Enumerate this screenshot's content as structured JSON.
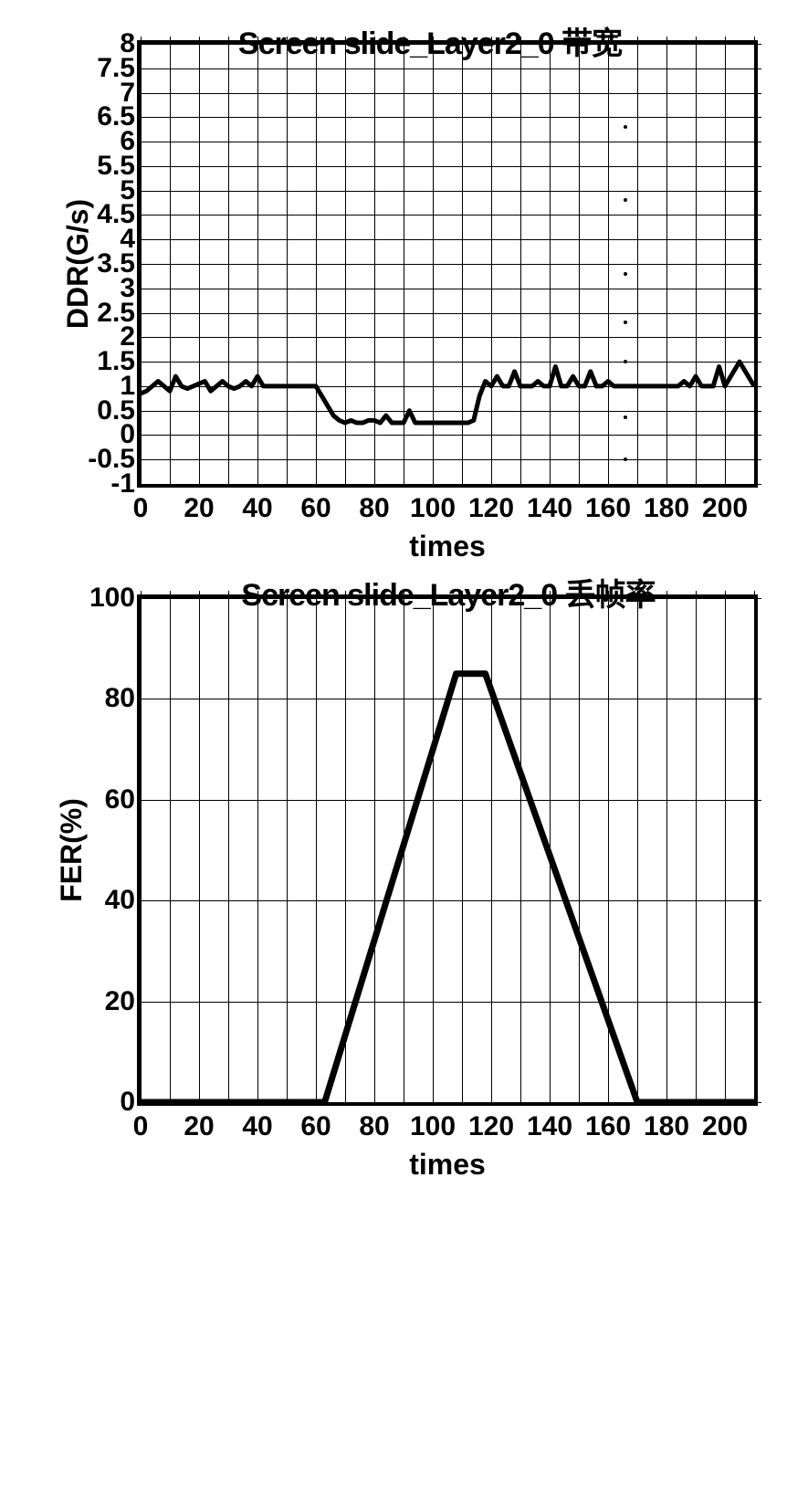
{
  "chart_data": [
    {
      "type": "line",
      "title": "Screen slide_Layer2_0 带宽",
      "xlabel": "times",
      "ylabel": "DDR(G/s)",
      "xlim": [
        0,
        210
      ],
      "ylim": [
        -1,
        8
      ],
      "xticks": [
        0,
        20,
        40,
        60,
        80,
        100,
        120,
        140,
        160,
        180,
        200
      ],
      "yticks": [
        -1,
        -0.5,
        0,
        0.5,
        1,
        1.5,
        2,
        2.5,
        3,
        3.5,
        4,
        4.5,
        5,
        5.5,
        6,
        6.5,
        7,
        7.5,
        8
      ],
      "x": [
        0,
        2,
        4,
        6,
        8,
        10,
        12,
        14,
        16,
        18,
        20,
        22,
        24,
        26,
        28,
        30,
        32,
        34,
        36,
        38,
        40,
        42,
        44,
        46,
        48,
        50,
        52,
        54,
        56,
        58,
        60,
        62,
        64,
        66,
        68,
        70,
        72,
        74,
        76,
        78,
        80,
        82,
        84,
        86,
        88,
        90,
        92,
        94,
        96,
        98,
        100,
        102,
        104,
        106,
        108,
        110,
        112,
        114,
        116,
        118,
        120,
        122,
        124,
        126,
        128,
        130,
        132,
        134,
        136,
        138,
        140,
        142,
        144,
        146,
        148,
        150,
        152,
        154,
        156,
        158,
        160,
        162,
        164,
        166,
        168,
        170,
        172,
        174,
        176,
        178,
        180,
        182,
        184,
        186,
        188,
        190,
        192,
        194,
        196,
        198,
        200,
        205,
        210
      ],
      "y": [
        0.85,
        0.9,
        1.0,
        1.1,
        1.0,
        0.9,
        1.2,
        1.0,
        0.95,
        1.0,
        1.05,
        1.1,
        0.9,
        1.0,
        1.1,
        1.0,
        0.95,
        1.0,
        1.1,
        1.0,
        1.2,
        1.0,
        1.0,
        1.0,
        1.0,
        1.0,
        1.0,
        1.0,
        1.0,
        1.0,
        1.0,
        0.8,
        0.6,
        0.4,
        0.3,
        0.25,
        0.3,
        0.25,
        0.25,
        0.3,
        0.3,
        0.25,
        0.4,
        0.25,
        0.25,
        0.25,
        0.5,
        0.25,
        0.25,
        0.25,
        0.25,
        0.25,
        0.25,
        0.25,
        0.25,
        0.25,
        0.25,
        0.3,
        0.8,
        1.1,
        1.0,
        1.2,
        1.0,
        1.0,
        1.3,
        1.0,
        1.0,
        1.0,
        1.1,
        1.0,
        1.0,
        1.4,
        1.0,
        1.0,
        1.2,
        1.0,
        1.0,
        1.3,
        1.0,
        1.0,
        1.1,
        1.0,
        1.0,
        1.0,
        1.0,
        1.0,
        1.0,
        1.0,
        1.0,
        1.0,
        1.0,
        1.0,
        1.0,
        1.1,
        1.0,
        1.2,
        1.0,
        1.0,
        1.0,
        1.4,
        1.0,
        1.5,
        1.0
      ]
    },
    {
      "type": "line",
      "title": "Screen slide_Layer2_0 丢帧率",
      "xlabel": "times",
      "ylabel": "FER(%)",
      "xlim": [
        0,
        210
      ],
      "ylim": [
        0,
        100
      ],
      "xticks": [
        0,
        20,
        40,
        60,
        80,
        100,
        120,
        140,
        160,
        180,
        200
      ],
      "yticks": [
        0,
        20,
        40,
        60,
        80,
        100
      ],
      "x": [
        0,
        60,
        63,
        108,
        118,
        170,
        210
      ],
      "y": [
        0,
        0,
        0,
        85,
        85,
        0,
        0
      ]
    }
  ]
}
